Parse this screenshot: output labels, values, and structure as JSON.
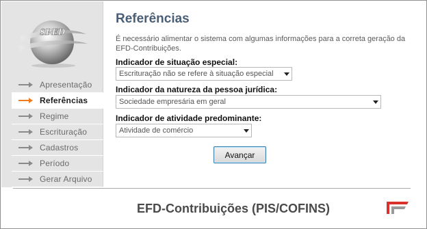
{
  "sidebar": {
    "logo_text": "SPED",
    "items": [
      {
        "label": "Apresentação",
        "active": false
      },
      {
        "label": "Referências",
        "active": true
      },
      {
        "label": "Regime",
        "active": false
      },
      {
        "label": "Escrituração",
        "active": false
      },
      {
        "label": "Cadastros",
        "active": false
      },
      {
        "label": "Período",
        "active": false
      },
      {
        "label": "Gerar Arquivo",
        "active": false
      }
    ]
  },
  "main": {
    "title": "Referências",
    "intro": "É necessário alimentar o sistema com algumas informações para a correta geração da EFD-Contribuições.",
    "fields": [
      {
        "label": "Indicador de situação especial:",
        "value": "Escrituração não se refere à situação especial"
      },
      {
        "label": "Indicador da natureza da pessoa jurídica:",
        "value": "Sociedade empresária em geral"
      },
      {
        "label": "Indicador de atividade predominante:",
        "value": "Atividade de comércio"
      }
    ],
    "next_button": "Avançar"
  },
  "footer": {
    "title": "EFD-Contribuições (PIS/COFINS)"
  },
  "colors": {
    "active_arrow": "#f07a1e",
    "inactive_arrow": "#8a8a8a",
    "title": "#4a5e76",
    "brand_red": "#d9312b"
  }
}
